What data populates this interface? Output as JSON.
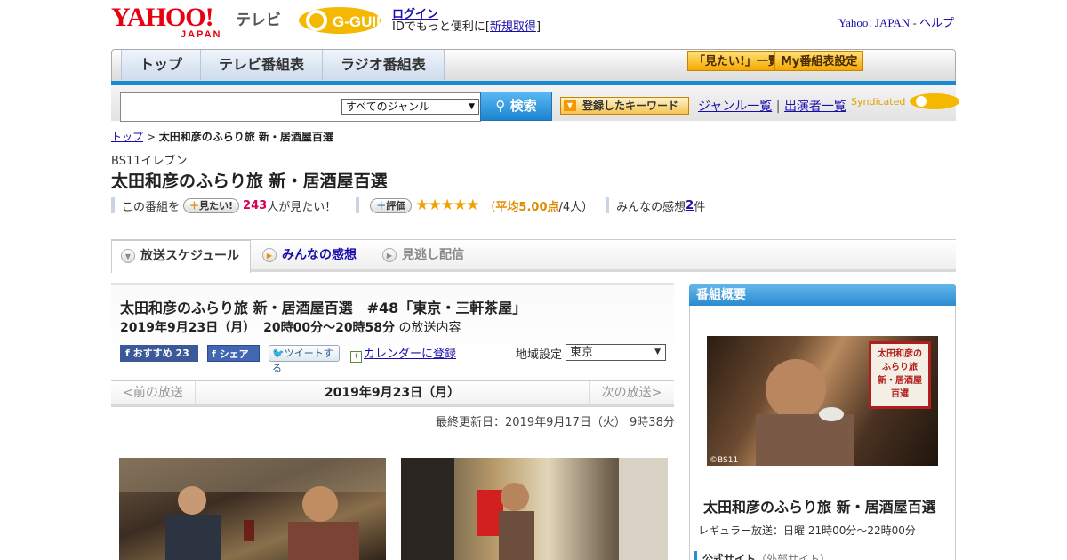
{
  "header": {
    "yahoo_logo": "YAHOO!",
    "yahoo_sub": "JAPAN",
    "tv_label": "テレビ",
    "gguide_logo": "G-GUIDE",
    "login": "ログイン",
    "login_sub_prefix": "IDでもっと便利に[",
    "signup": "新規取得",
    "login_sub_suffix": "]",
    "yahoo_japan_link": "Yahoo! JAPAN",
    "separator": " - ",
    "help_link": "ヘルプ"
  },
  "nav": {
    "tabs": [
      "トップ",
      "テレビ番組表",
      "ラジオ番組表"
    ],
    "mitai_list": "「見たい!」一覧",
    "my_settings": "My番組表設定"
  },
  "search": {
    "genre": "すべてのジャンル",
    "button": "検索",
    "keyword_button": "登録したキーワード",
    "genre_list": "ジャンル一覧",
    "divider": "|",
    "performer_list": "出演者一覧",
    "syndicated": "Syndicated"
  },
  "breadcrumb": {
    "top": "トップ",
    "arrow": " > ",
    "current": "太田和彦のふらり旅 新・居酒屋百選"
  },
  "program": {
    "channel": "BS11イレブン",
    "title": "太田和彦のふらり旅 新・居酒屋百選",
    "mitai_prefix": "この番組を",
    "mitai_button": "見たい!",
    "mitai_count": "243",
    "mitai_suffix": "人が見たい！",
    "rate_button": "評価",
    "stars": "★★★★★",
    "rating_open": "（",
    "rating_avg": "平均5.00点",
    "rating_count": "/4人）",
    "comments_prefix": "みんなの感想 ",
    "comments_count": "2",
    "comments_suffix": "件"
  },
  "tabs2": {
    "schedule": "放送スケジュール",
    "reviews": "みんなの感想",
    "streaming": "見逃し配信"
  },
  "episode": {
    "title": "太田和彦のふらり旅 新・居酒屋百選　#48「東京・三軒茶屋」",
    "date": "2019年9月23日（月）",
    "time": "20時00分～20時58分",
    "time_suffix": "の放送内容",
    "fb_recommend": "おすすめ 23",
    "fb_share": "シェア",
    "tweet": "ツイートする",
    "calendar": "カレンダーに登録",
    "region_label": "地域設定",
    "region": "東京"
  },
  "date_nav": {
    "prev": "<前の放送",
    "current": "2019年9月23日（月）",
    "next": "次の放送>"
  },
  "updated": "最終更新日：2019年9月17日（火） 9時38分",
  "sidebar": {
    "header": "番組概要",
    "photo_credit": "©BS11",
    "seal_text": "太田和彦のふらり旅 新・居酒屋百選",
    "title": "太田和彦のふらり旅 新・居酒屋百選",
    "regular": "レギュラー放送：日曜 21時00分～22時00分",
    "official_site": "公式サイト",
    "official_site_note": "（外部サイト）"
  }
}
